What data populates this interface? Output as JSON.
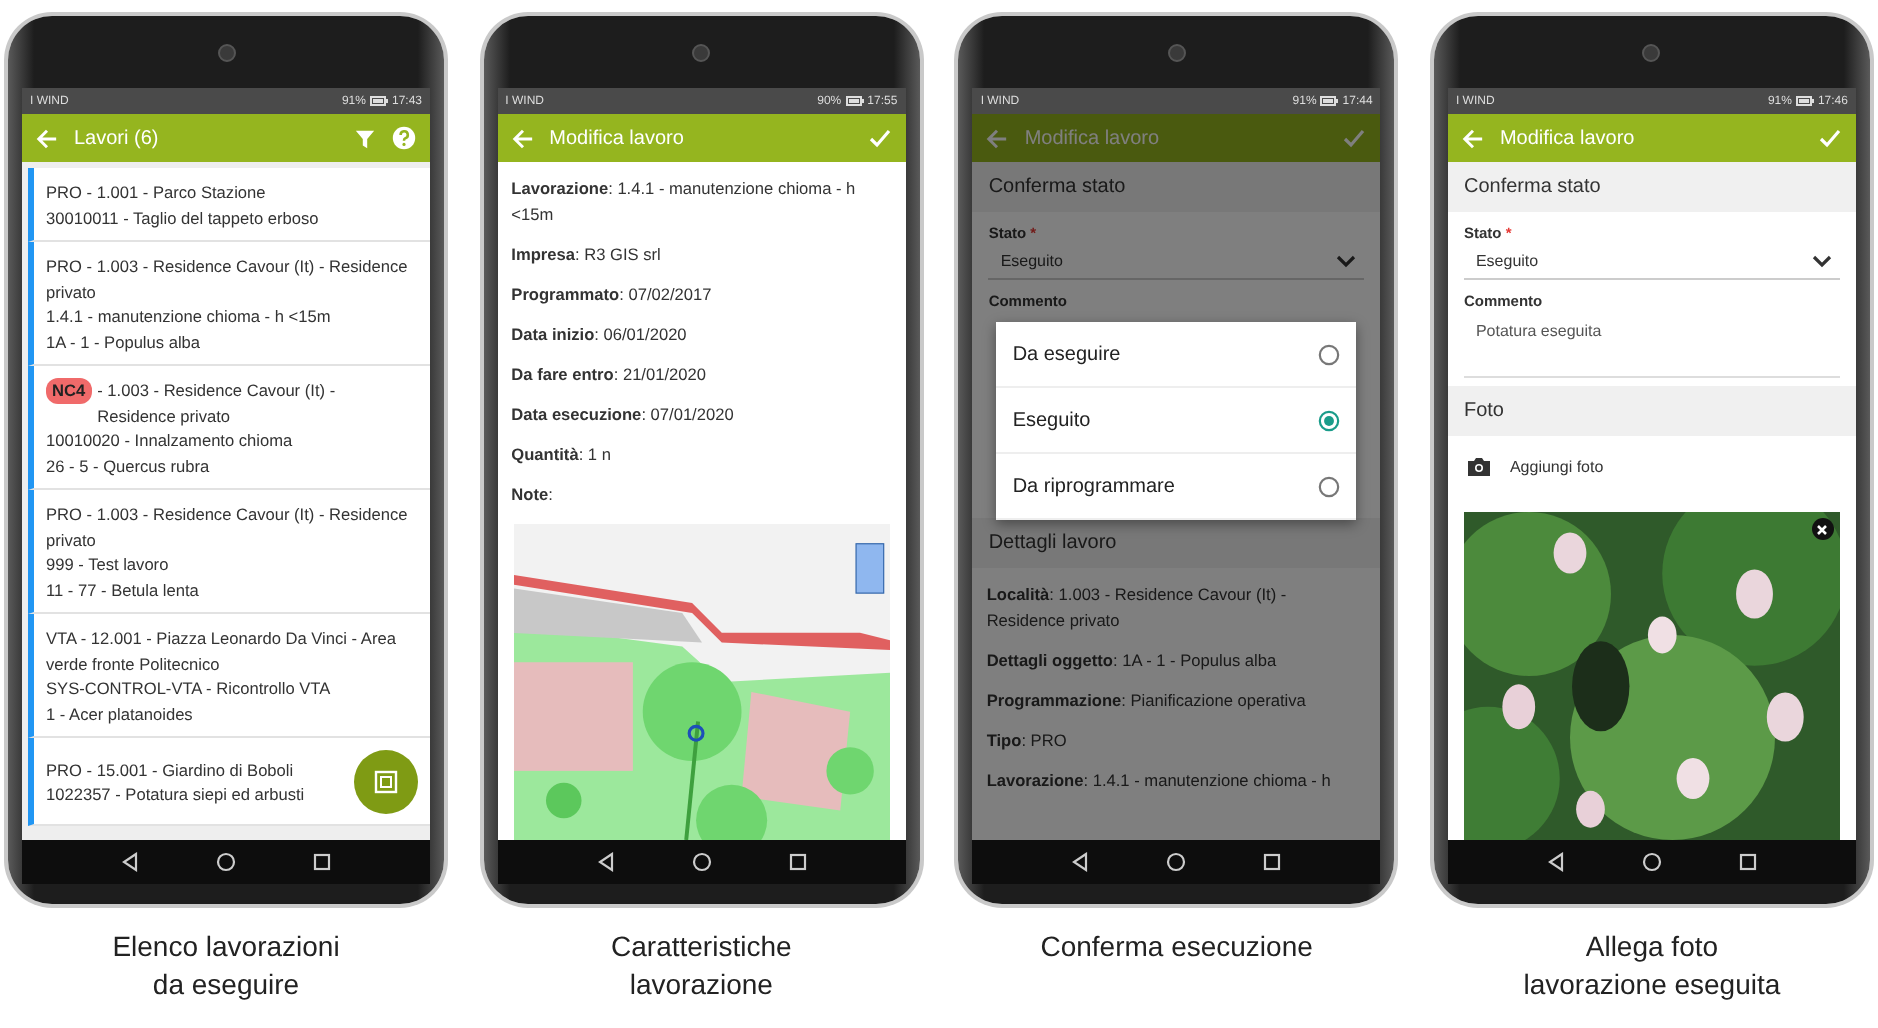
{
  "phones": [
    {
      "status": {
        "carrier": "I WIND",
        "battery": "91%",
        "time": "17:43"
      },
      "appbar": {
        "title": "Lavori (6)",
        "actions": [
          {
            "kind": "filter"
          },
          {
            "kind": "help"
          }
        ]
      },
      "fab": true,
      "blocks": [
        {
          "kind": "item",
          "lines": [
            "PRO - 1.001 - Parco Stazione",
            "30010011 - Taglio del tappeto erboso"
          ]
        },
        {
          "kind": "item",
          "lines": [
            "PRO - 1.003 - Residence Cavour (It) - Residence privato",
            "1.4.1 - manutenzione chioma - h <15m",
            "1A - 1 - Populus alba"
          ]
        },
        {
          "kind": "item",
          "badge": "NC4",
          "lines": [
            "- 1.003 - Residence Cavour (It) - Residence privato",
            "10010020 - Innalzamento chioma",
            "26 - 5 - Quercus rubra"
          ]
        },
        {
          "kind": "item",
          "lines": [
            "PRO - 1.003 - Residence Cavour (It) - Residence privato",
            "999 - Test lavoro",
            "11 - 77 - Betula lenta"
          ]
        },
        {
          "kind": "item",
          "lines": [
            "VTA - 12.001 - Piazza Leonardo Da Vinci - Area verde fronte Politecnico",
            "SYS-CONTROL-VTA - Ricontrollo VTA",
            "1 - Acer platanoides"
          ]
        },
        {
          "kind": "item",
          "lines": [
            "PRO - 15.001 - Giardino di Boboli",
            "1022357 - Potatura siepi ed arbusti"
          ]
        }
      ],
      "caption": "Elenco lavorazioni\nda eseguire"
    },
    {
      "status": {
        "carrier": "I WIND",
        "battery": "90%",
        "time": "17:55"
      },
      "appbar": {
        "title": "Modifica lavoro",
        "actions": [
          {
            "kind": "confirm"
          }
        ]
      },
      "blocks": [
        {
          "kind": "kv",
          "text": "**Lavorazione**: 1.4.1 - manutenzione chioma - h <15m"
        },
        {
          "kind": "kv",
          "text": "**Impresa**: R3 GIS srl"
        },
        {
          "kind": "kv",
          "text": "**Programmato**: 07/02/2017"
        },
        {
          "kind": "kv",
          "text": "**Data inizio**: 06/01/2020"
        },
        {
          "kind": "kv",
          "text": "**Da fare entro**: 21/01/2020"
        },
        {
          "kind": "kv",
          "text": "**Data esecuzione**: 07/01/2020"
        },
        {
          "kind": "kv",
          "text": "**Quantità**: 1 n"
        },
        {
          "kind": "kv",
          "text": "**Note**:"
        },
        {
          "kind": "picture"
        }
      ],
      "caption": "Caratteristiche\nlavorazione"
    },
    {
      "status": {
        "carrier": "I WIND",
        "battery": "91%",
        "time": "17:44"
      },
      "appbar": {
        "title": "Modifica lavoro",
        "actions": [
          {
            "kind": "confirm"
          }
        ]
      },
      "dialog": {
        "options": [
          {
            "label": "Da eseguire",
            "selected": false
          },
          {
            "label": "Eseguito",
            "selected": true
          },
          {
            "label": "Da riprogrammare",
            "selected": false
          }
        ]
      },
      "blocks": [
        {
          "kind": "section",
          "title": "Conferma stato"
        },
        {
          "kind": "select",
          "label": "Stato",
          "required_mark": "*",
          "value": "Eseguito"
        },
        {
          "kind": "textarea",
          "label": "Commento"
        },
        {
          "kind": "section",
          "title": "Dettagli lavoro"
        },
        {
          "kind": "kv",
          "text": "**Località**: 1.003 - Residence Cavour (It) - Residence privato"
        },
        {
          "kind": "kv",
          "text": "**Dettagli oggetto**: 1A - 1 - Populus alba"
        },
        {
          "kind": "kv",
          "text": "**Programmazione**: Pianificazione operativa"
        },
        {
          "kind": "kv",
          "text": "**Tipo**: PRO"
        },
        {
          "kind": "kv",
          "text": "**Lavorazione**: 1.4.1 - manutenzione chioma - h"
        }
      ],
      "caption": "Conferma esecuzione"
    },
    {
      "status": {
        "carrier": "I WIND",
        "battery": "91%",
        "time": "17:46"
      },
      "appbar": {
        "title": "Modifica lavoro",
        "actions": [
          {
            "kind": "confirm"
          }
        ]
      },
      "blocks": [
        {
          "kind": "section",
          "title": "Conferma stato"
        },
        {
          "kind": "select",
          "label": "Stato",
          "required_mark": "*",
          "value": "Eseguito"
        },
        {
          "kind": "textarea",
          "label": "Commento",
          "value": "Potatura eseguita"
        },
        {
          "kind": "section",
          "title": "Foto"
        },
        {
          "kind": "action",
          "label": "Aggiungi foto"
        },
        {
          "kind": "picture",
          "removable": true
        }
      ],
      "caption": "Allega foto\nlavorazione eseguita"
    }
  ]
}
